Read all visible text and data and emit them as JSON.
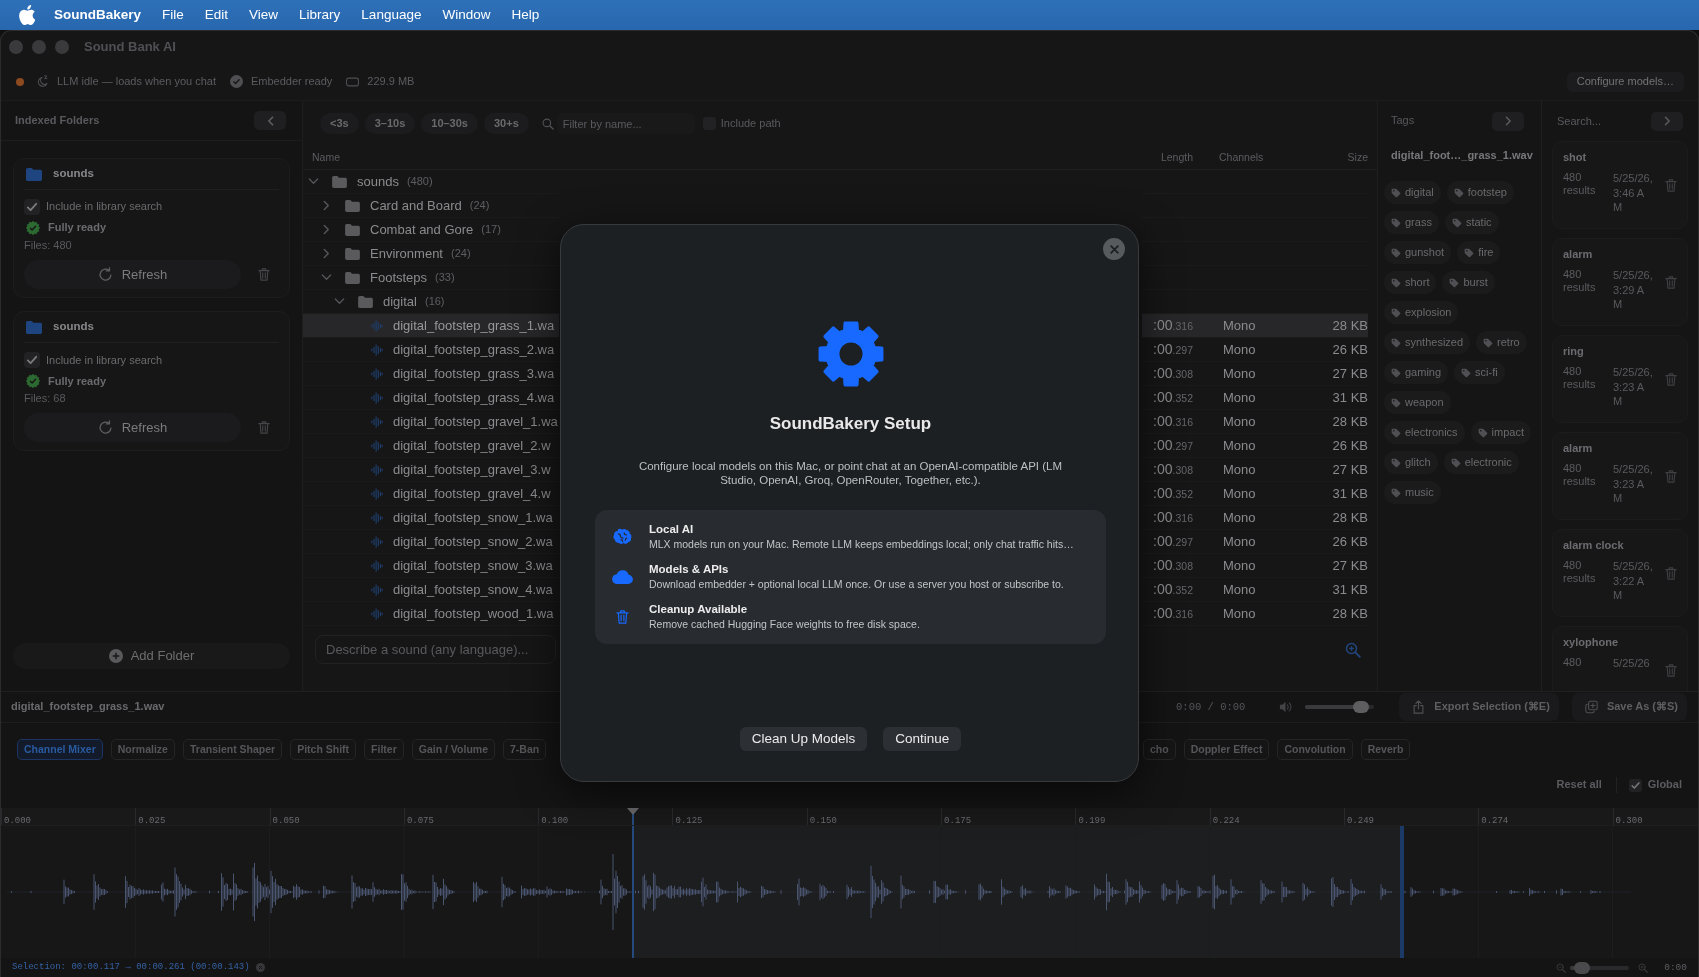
{
  "menu_bar": {
    "app_name": "SoundBakery",
    "items": [
      "File",
      "Edit",
      "View",
      "Library",
      "Language",
      "Window",
      "Help"
    ]
  },
  "window": {
    "title": "Sound Bank AI"
  },
  "status_bar": {
    "items": [
      {
        "kind": "llm",
        "text": "LLM idle — loads when you chat"
      },
      {
        "kind": "embedder",
        "text": "Embedder ready"
      },
      {
        "kind": "memory",
        "text": "229.9 MB"
      }
    ],
    "configure_button": "Configure models…"
  },
  "sidebar": {
    "title": "Indexed Folders",
    "folders": [
      {
        "name": "sounds",
        "include": {
          "label": "Include in library search",
          "checked": true
        },
        "status": "Fully ready",
        "files": "Files: 480",
        "refresh_button": "Refresh"
      },
      {
        "name": "sounds",
        "include": {
          "label": "Include in library search",
          "checked": true
        },
        "status": "Fully ready",
        "files": "Files: 68",
        "refresh_button": "Refresh"
      }
    ],
    "add_button": "Add Folder"
  },
  "filters": {
    "durations": [
      "<3s",
      "3–10s",
      "10–30s",
      "30+s"
    ],
    "search": {
      "placeholder": "Filter by name..."
    },
    "include_path": {
      "label": "Include path",
      "checked": false
    }
  },
  "file_table": {
    "columns": [
      "Name",
      "Length",
      "Channels",
      "Size"
    ],
    "tree": [
      {
        "kind": "folder",
        "name": "sounds",
        "count": "(480)",
        "expanded": true,
        "selected": false,
        "children": [
          {
            "kind": "folder",
            "name": "Card and Board",
            "count": "(24)",
            "expanded": false,
            "selected": false
          },
          {
            "kind": "folder",
            "name": "Combat and Gore",
            "count": "(17)",
            "expanded": false,
            "selected": false
          },
          {
            "kind": "folder",
            "name": "Environment",
            "count": "(24)",
            "expanded": false,
            "selected": false
          },
          {
            "kind": "folder",
            "name": "Footsteps",
            "count": "(33)",
            "expanded": true,
            "selected": false,
            "children": [
              {
                "kind": "folder",
                "name": "digital",
                "count": "(16)",
                "expanded": true,
                "selected": false,
                "children": [
                  {
                    "kind": "file",
                    "name": "digital_footstep_grass_1.wa",
                    "length": ":00.316",
                    "channels": "Mono",
                    "size": "28 KB",
                    "selected": true
                  },
                  {
                    "kind": "file",
                    "name": "digital_footstep_grass_2.wa",
                    "length": ":00.297",
                    "channels": "Mono",
                    "size": "26 KB",
                    "selected": false
                  },
                  {
                    "kind": "file",
                    "name": "digital_footstep_grass_3.wa",
                    "length": ":00.308",
                    "channels": "Mono",
                    "size": "27 KB",
                    "selected": false
                  },
                  {
                    "kind": "file",
                    "name": "digital_footstep_grass_4.wa",
                    "length": ":00.352",
                    "channels": "Mono",
                    "size": "31 KB",
                    "selected": false
                  },
                  {
                    "kind": "file",
                    "name": "digital_footstep_gravel_1.wa",
                    "length": ":00.316",
                    "channels": "Mono",
                    "size": "28 KB",
                    "selected": false
                  },
                  {
                    "kind": "file",
                    "name": "digital_footstep_gravel_2.w",
                    "length": ":00.297",
                    "channels": "Mono",
                    "size": "26 KB",
                    "selected": false
                  },
                  {
                    "kind": "file",
                    "name": "digital_footstep_gravel_3.w",
                    "length": ":00.308",
                    "channels": "Mono",
                    "size": "27 KB",
                    "selected": false
                  },
                  {
                    "kind": "file",
                    "name": "digital_footstep_gravel_4.w",
                    "length": ":00.352",
                    "channels": "Mono",
                    "size": "31 KB",
                    "selected": false
                  },
                  {
                    "kind": "file",
                    "name": "digital_footstep_snow_1.wa",
                    "length": ":00.316",
                    "channels": "Mono",
                    "size": "28 KB",
                    "selected": false
                  },
                  {
                    "kind": "file",
                    "name": "digital_footstep_snow_2.wa",
                    "length": ":00.297",
                    "channels": "Mono",
                    "size": "26 KB",
                    "selected": false
                  },
                  {
                    "kind": "file",
                    "name": "digital_footstep_snow_3.wa",
                    "length": ":00.308",
                    "channels": "Mono",
                    "size": "27 KB",
                    "selected": false
                  },
                  {
                    "kind": "file",
                    "name": "digital_footstep_snow_4.wa",
                    "length": ":00.352",
                    "channels": "Mono",
                    "size": "31 KB",
                    "selected": false
                  },
                  {
                    "kind": "file",
                    "name": "digital_footstep_wood_1.wa",
                    "length": ":00.316",
                    "channels": "Mono",
                    "size": "28 KB",
                    "selected": false
                  }
                ]
              }
            ]
          }
        ]
      }
    ]
  },
  "chat": {
    "placeholder": "Describe a sound (any language)..."
  },
  "tags_panel": {
    "title": "Tags",
    "file": "digital_foot…_grass_1.wav",
    "tags": [
      "digital",
      "footstep",
      "grass",
      "static",
      "gunshot",
      "fire",
      "short",
      "burst",
      "explosion",
      "synthesized",
      "retro",
      "gaming",
      "sci-fi",
      "weapon",
      "electronics",
      "impact",
      "glitch",
      "electronic",
      "music"
    ]
  },
  "search_history": {
    "search": {
      "placeholder": "Search..."
    },
    "entries": [
      {
        "query": "shot",
        "results": "480 results",
        "date": "5/25/26, 3:46 AM"
      },
      {
        "query": "alarm",
        "results": "480 results",
        "date": "5/25/26, 3:29 AM"
      },
      {
        "query": "ring",
        "results": "480 results",
        "date": "5/25/26, 3:23 AM"
      },
      {
        "query": "alarm",
        "results": "480 results",
        "date": "5/25/26, 3:23 AM"
      },
      {
        "query": "alarm clock",
        "results": "480 results",
        "date": "5/25/26, 3:22 AM"
      },
      {
        "query": "xylophone",
        "results": "480",
        "date": "5/25/26"
      }
    ]
  },
  "player": {
    "file": "digital_footstep_grass_1.wav",
    "time": "0:00 / 0:00",
    "volume": {
      "level": 0.9
    },
    "buttons": [
      {
        "kind": "export",
        "label": "Export Selection (⌘E)"
      },
      {
        "kind": "save",
        "label": "Save As (⌘S)"
      }
    ]
  },
  "effects_left": [
    {
      "label": "Channel Mixer",
      "selected": true
    },
    {
      "label": "Normalize",
      "selected": false
    },
    {
      "label": "Transient Shaper",
      "selected": false
    },
    {
      "label": "Pitch Shift",
      "selected": false
    },
    {
      "label": "Filter",
      "selected": false
    },
    {
      "label": "Gain / Volume",
      "selected": false
    },
    {
      "label": "7-Ban",
      "selected": false
    }
  ],
  "effects_right": [
    {
      "label": "cho",
      "selected": false
    },
    {
      "label": "Doppler Effect",
      "selected": false
    },
    {
      "label": "Convolution",
      "selected": false
    },
    {
      "label": "Reverb",
      "selected": false
    }
  ],
  "effect_options": {
    "reset_button": "Reset all",
    "global": {
      "label": "Global",
      "checked": true
    }
  },
  "timeline": {
    "ruler": [
      "0.000",
      "0.025",
      "0.050",
      "0.075",
      "0.100",
      "0.125",
      "0.150",
      "0.175",
      "0.199",
      "0.224",
      "0.249",
      "0.274",
      "0.300"
    ],
    "selection": "Selection: 00:00.117 → 00:00.261 (00:00.143)",
    "zoom": {
      "level": 0.1
    },
    "duration": "0:00"
  },
  "dialog": {
    "title": "SoundBakery Setup",
    "description": "Configure local models on this Mac, or point chat at an OpenAI-compatible API (LM Studio, OpenAI, Groq, OpenRouter, Together, etc.).",
    "items": [
      {
        "kind": "local",
        "title": "Local AI",
        "text": "MLX models run on your Mac. Remote LLM keeps embeddings local; only chat traffic hits…"
      },
      {
        "kind": "models",
        "title": "Models & APIs",
        "text": "Download embedder + optional local LLM once. Or use a server you host or subscribe to."
      },
      {
        "kind": "cleanup",
        "title": "Cleanup Available",
        "text": "Remove cached Hugging Face weights to free disk space."
      }
    ],
    "buttons": [
      "Clean Up Models",
      "Continue"
    ]
  }
}
